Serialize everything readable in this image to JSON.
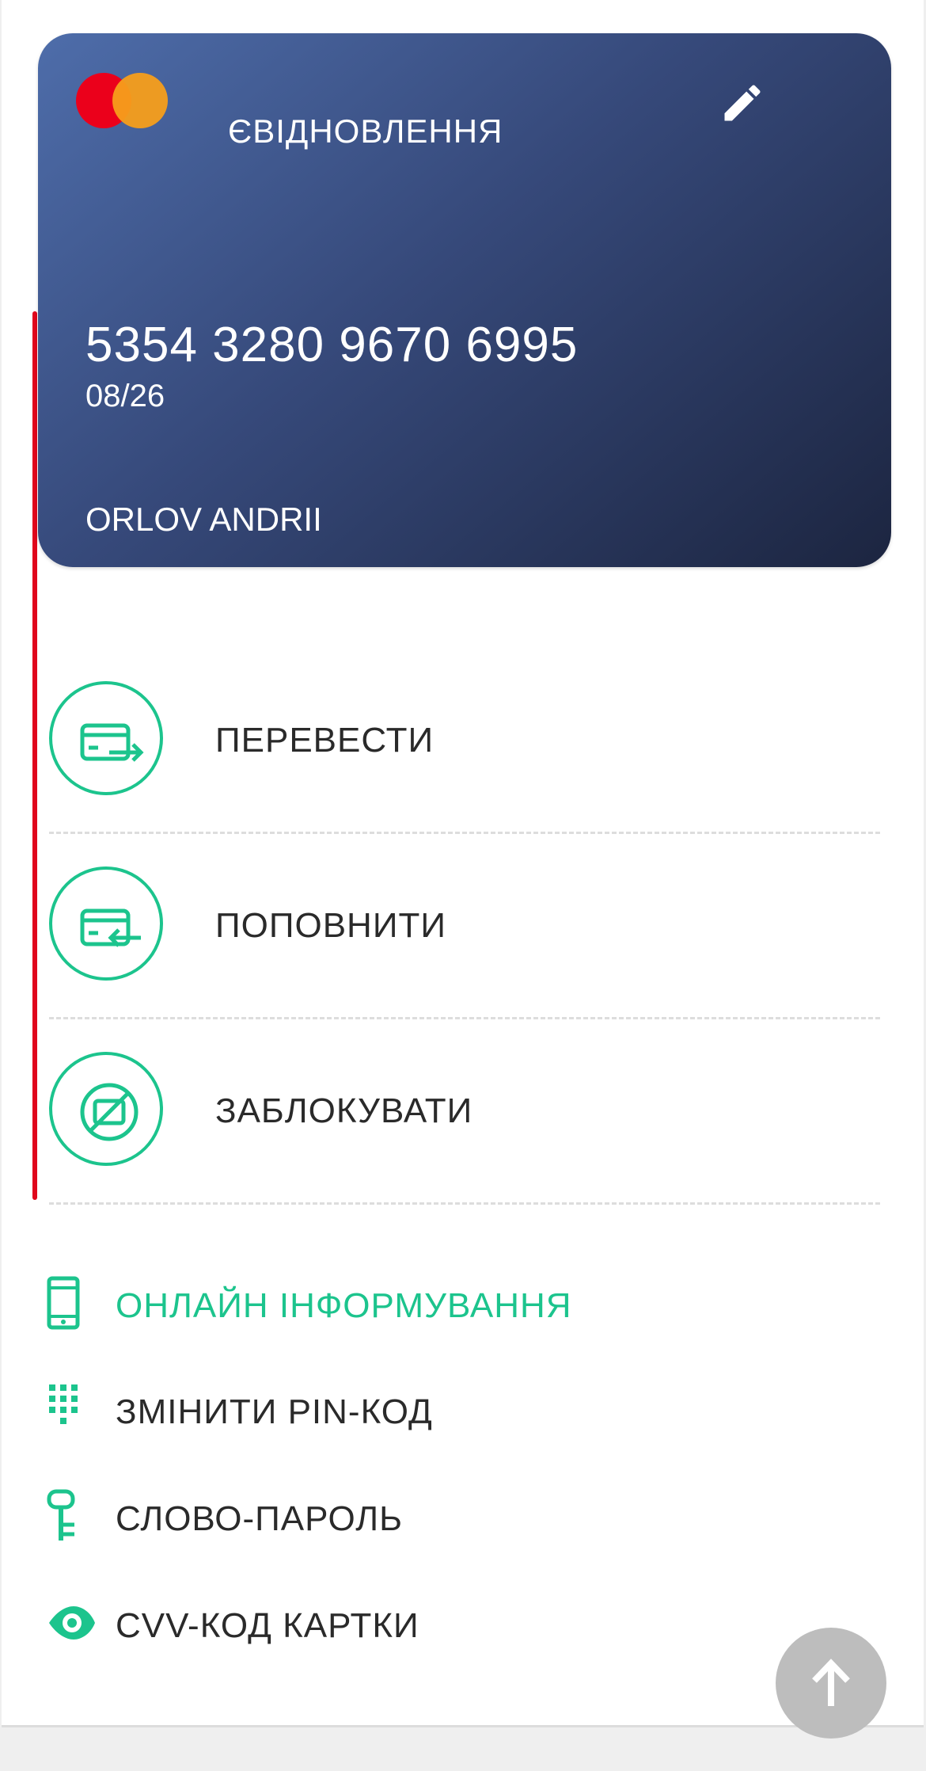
{
  "card": {
    "name": "ЄВІДНОВЛЕННЯ",
    "number": "5354 3280 9670 6995",
    "expiry": "08/26",
    "holder": "ORLOV ANDRII",
    "brand_icon": "mastercard-logo",
    "edit_icon": "pencil-icon"
  },
  "actions": [
    {
      "label": "ПЕРЕВЕСТИ",
      "icon": "card-transfer-out-icon"
    },
    {
      "label": "ПОПОВНИТИ",
      "icon": "card-top-up-icon"
    },
    {
      "label": "ЗАБЛОКУВАТИ",
      "icon": "card-block-icon"
    }
  ],
  "links": [
    {
      "label": "ОНЛАЙН ІНФОРМУВАННЯ",
      "icon": "phone-icon"
    },
    {
      "label": "ЗМІНИТИ PIN-КОД",
      "icon": "keypad-icon"
    },
    {
      "label": "СЛОВО-ПАРОЛЬ",
      "icon": "key-icon"
    },
    {
      "label": "CVV-КОД КАРТКИ",
      "icon": "eye-icon"
    }
  ],
  "colors": {
    "accent": "#1cc48d",
    "card_gradient_start": "#4e6daa",
    "card_gradient_end": "#1c2540",
    "marker": "#e0061c"
  },
  "scroll_top_icon": "arrow-up-icon"
}
